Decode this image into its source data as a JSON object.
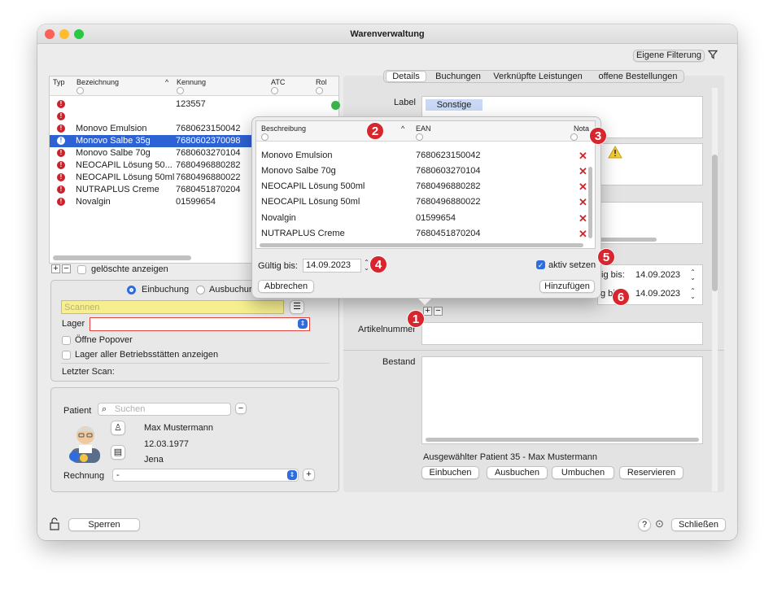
{
  "window": {
    "title": "Warenverwaltung"
  },
  "toolbar": {
    "filter_button": "Eigene Filterung"
  },
  "table": {
    "headers": {
      "typ": "Typ",
      "bezeichnung": "Bezeichnung",
      "kennung": "Kennung",
      "atc": "ATC",
      "rol": "Rol"
    },
    "rows": [
      {
        "bezeichnung": "",
        "kennung": "123557"
      },
      {
        "bezeichnung": "",
        "kennung": ""
      },
      {
        "bezeichnung": "Monovo Emulsion",
        "kennung": "7680623150042"
      },
      {
        "bezeichnung": "Monovo Salbe 35g",
        "kennung": "7680602370098"
      },
      {
        "bezeichnung": "Monovo Salbe 70g",
        "kennung": "7680603270104"
      },
      {
        "bezeichnung": "NEOCAPIL Lösung 50...",
        "kennung": "7680496880282"
      },
      {
        "bezeichnung": "NEOCAPIL Lösung 50ml",
        "kennung": "7680496880022"
      },
      {
        "bezeichnung": "NUTRAPLUS Creme",
        "kennung": "7680451870204"
      },
      {
        "bezeichnung": "Novalgin",
        "kennung": "01599654"
      }
    ],
    "show_deleted": "gelöschte anzeigen"
  },
  "booking": {
    "radio_in": "Einbuchung",
    "radio_out": "Ausbuchur",
    "scan_placeholder": "Scannen",
    "lager_label": "Lager",
    "open_popover": "Öffne Popover",
    "all_sites": "Lager aller Betriebsstätten anzeigen",
    "last_scan": "Letzter Scan:"
  },
  "patient": {
    "label": "Patient",
    "search_placeholder": "Suchen",
    "name": "Max Mustermann",
    "dob": "12.03.1977",
    "city": "Jena",
    "invoice_label": "Rechnung",
    "invoice_value": "-"
  },
  "footer": {
    "lock": "Sperren",
    "help": "?",
    "close": "Schließen"
  },
  "tabs": [
    "Details",
    "Buchungen",
    "Verknüpfte Leistungen",
    "offene Bestellungen"
  ],
  "details": {
    "label_label": "Label",
    "label_tag": "Sonstige",
    "valid_until_1_label": "tig bis:",
    "valid_until_1": "14.09.2023",
    "valid_until_2_label": "g bis:",
    "valid_until_2": "14.09.2023",
    "article_no_label": "Artikelnummer",
    "stock_label": "Bestand",
    "selected_patient": "Ausgewählter Patient 35 - Max Mustermann",
    "actions": [
      "Einbuchen",
      "Ausbuchen",
      "Umbuchen",
      "Reservieren"
    ]
  },
  "popover": {
    "headers": {
      "beschreibung": "Beschreibung",
      "ean": "EAN",
      "nota": "Nota"
    },
    "rows": [
      {
        "beschreibung": "Monovo Emulsion",
        "ean": "7680623150042"
      },
      {
        "beschreibung": "Monovo Salbe 70g",
        "ean": "7680603270104"
      },
      {
        "beschreibung": "NEOCAPIL Lösung 500ml",
        "ean": "7680496880282"
      },
      {
        "beschreibung": "NEOCAPIL Lösung 50ml",
        "ean": "7680496880022"
      },
      {
        "beschreibung": "Novalgin",
        "ean": "01599654"
      },
      {
        "beschreibung": "NUTRAPLUS Creme",
        "ean": "7680451870204"
      }
    ],
    "valid_label": "Gültig bis:",
    "valid_value": "14.09.2023",
    "active_label": "aktiv setzen",
    "cancel": "Abbrechen",
    "add": "Hinzufügen"
  },
  "callouts": [
    "1",
    "2",
    "3",
    "4",
    "5",
    "6"
  ],
  "colors": {
    "selection": "#2d62d5",
    "callout": "#d7262d",
    "scan_field": "#f7ef8f",
    "label_tag": "#c8d8f5"
  }
}
